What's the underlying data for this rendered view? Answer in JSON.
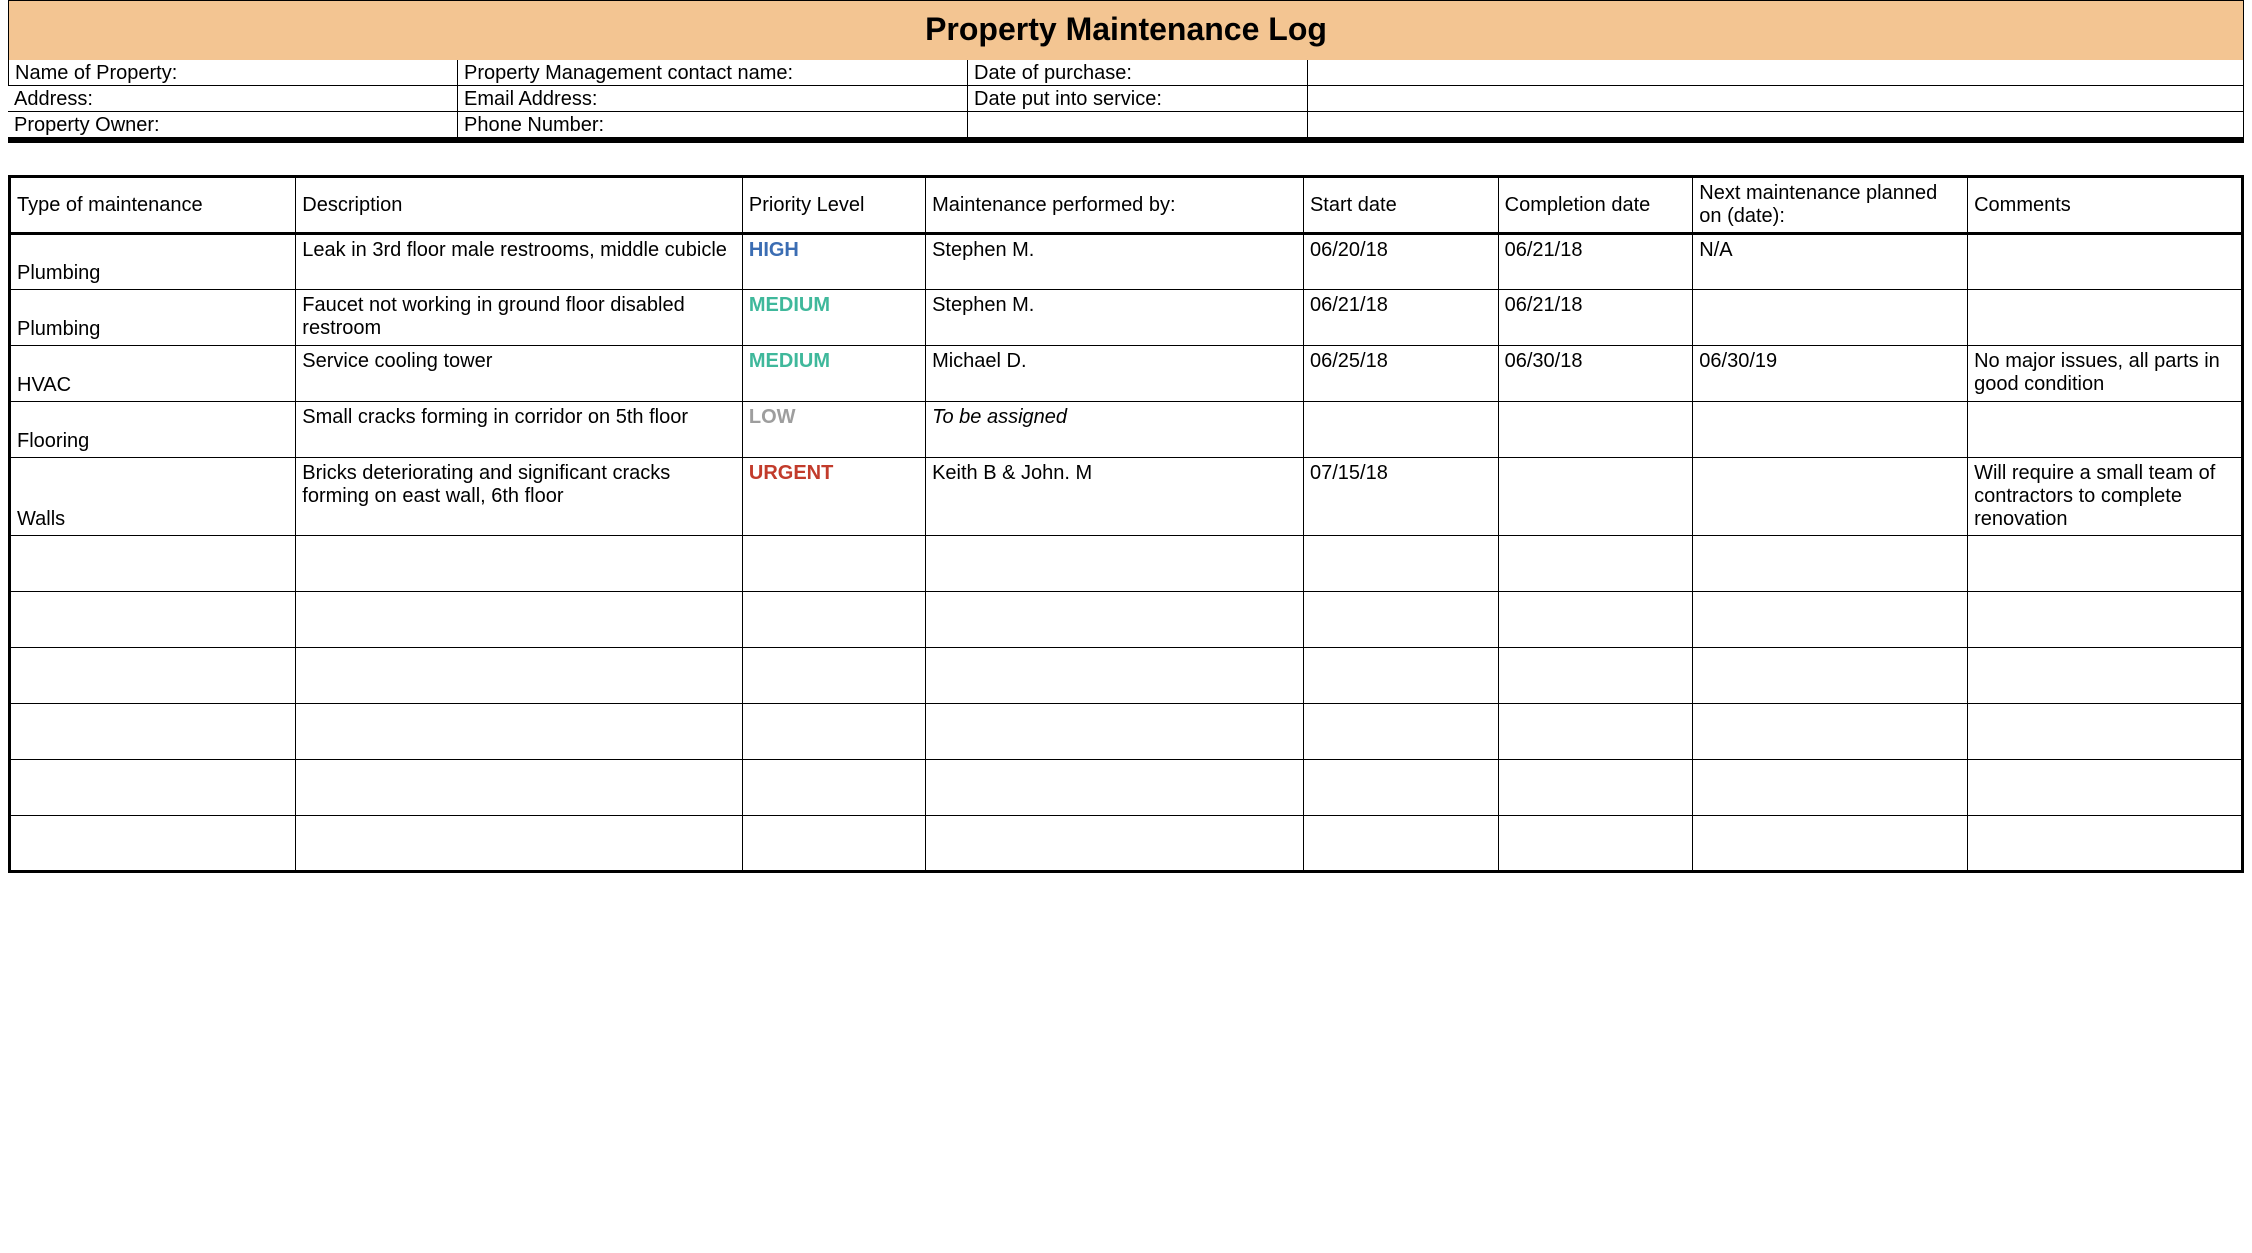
{
  "title": "Property Maintenance Log",
  "info": {
    "row1": {
      "c1": "Name of Property:",
      "c2": "Property Management contact name:",
      "c3": "Date of purchase:",
      "c4": ""
    },
    "row2": {
      "c1": "Address:",
      "c2": "Email Address:",
      "c3": "Date put into service:",
      "c4": ""
    },
    "row3": {
      "c1": "Property Owner:",
      "c2": "Phone Number:",
      "c3": "",
      "c4": ""
    }
  },
  "columns": {
    "type": "Type of maintenance",
    "description": "Description",
    "priority": "Priority Level",
    "performed_by": "Maintenance performed by:",
    "start_date": "Start date",
    "completion_date": "Completion date",
    "next_maintenance": "Next maintenance planned on (date):",
    "comments": "Comments"
  },
  "rows": [
    {
      "type": "Plumbing",
      "description": "Leak in 3rd floor male restrooms, middle cubicle",
      "priority": "HIGH",
      "performed_by": "Stephen M.",
      "performed_by_italic": false,
      "start_date": "06/20/18",
      "completion_date": "06/21/18",
      "next_maintenance": "N/A",
      "comments": ""
    },
    {
      "type": "Plumbing",
      "description": "Faucet not working in ground floor disabled restroom",
      "priority": "MEDIUM",
      "performed_by": "Stephen M.",
      "performed_by_italic": false,
      "start_date": "06/21/18",
      "completion_date": "06/21/18",
      "next_maintenance": "",
      "comments": ""
    },
    {
      "type": "HVAC",
      "description": "Service cooling tower",
      "priority": "MEDIUM",
      "performed_by": "Michael D.",
      "performed_by_italic": false,
      "start_date": "06/25/18",
      "completion_date": "06/30/18",
      "next_maintenance": "06/30/19",
      "comments": "No major issues, all parts in good condition"
    },
    {
      "type": "Flooring",
      "description": "Small cracks forming in corridor on 5th floor",
      "priority": "LOW",
      "performed_by": "To be assigned",
      "performed_by_italic": true,
      "start_date": "",
      "completion_date": "",
      "next_maintenance": "",
      "comments": ""
    },
    {
      "type": "Walls",
      "description": "Bricks deteriorating and significant cracks forming on east wall, 6th floor",
      "priority": "URGENT",
      "performed_by": "Keith B & John. M",
      "performed_by_italic": false,
      "start_date": "07/15/18",
      "completion_date": "",
      "next_maintenance": "",
      "comments": "Will require a small team of contractors to complete renovation"
    },
    {
      "type": "",
      "description": "",
      "priority": "",
      "performed_by": "",
      "performed_by_italic": false,
      "start_date": "",
      "completion_date": "",
      "next_maintenance": "",
      "comments": ""
    },
    {
      "type": "",
      "description": "",
      "priority": "",
      "performed_by": "",
      "performed_by_italic": false,
      "start_date": "",
      "completion_date": "",
      "next_maintenance": "",
      "comments": ""
    },
    {
      "type": "",
      "description": "",
      "priority": "",
      "performed_by": "",
      "performed_by_italic": false,
      "start_date": "",
      "completion_date": "",
      "next_maintenance": "",
      "comments": ""
    },
    {
      "type": "",
      "description": "",
      "priority": "",
      "performed_by": "",
      "performed_by_italic": false,
      "start_date": "",
      "completion_date": "",
      "next_maintenance": "",
      "comments": ""
    },
    {
      "type": "",
      "description": "",
      "priority": "",
      "performed_by": "",
      "performed_by_italic": false,
      "start_date": "",
      "completion_date": "",
      "next_maintenance": "",
      "comments": ""
    },
    {
      "type": "",
      "description": "",
      "priority": "",
      "performed_by": "",
      "performed_by_italic": false,
      "start_date": "",
      "completion_date": "",
      "next_maintenance": "",
      "comments": ""
    }
  ]
}
